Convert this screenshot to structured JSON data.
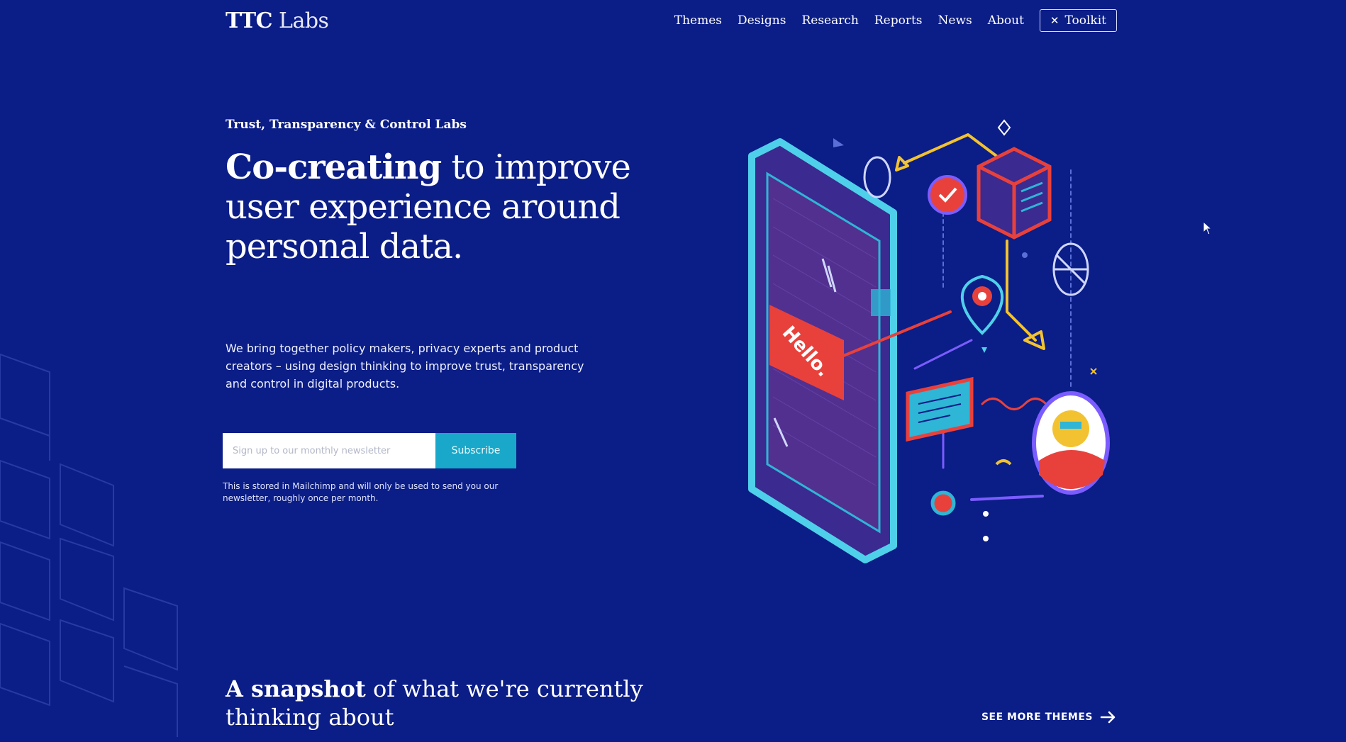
{
  "header": {
    "logo_bold": "TTC",
    "logo_light": "Labs",
    "nav": [
      "Themes",
      "Designs",
      "Research",
      "Reports",
      "News",
      "About"
    ],
    "toolkit_label": "Toolkit",
    "toolkit_icon": "tools-icon"
  },
  "hero": {
    "eyebrow": "Trust, Transparency & Control Labs",
    "headline_strong": "Co-creating",
    "headline_rest": "to improve user experience around personal data.",
    "intro": "We bring together policy makers, privacy experts and product creators – using design thinking to improve trust, transparency and control in digital products.",
    "newsletter": {
      "placeholder": "Sign up to our monthly newsletter",
      "button": "Subscribe",
      "fineprint": "This is stored in Mailchimp and will only be used to send you our newsletter, roughly once per month."
    },
    "illustration": {
      "phone_text": "Hello."
    }
  },
  "snapshot": {
    "title_strong": "A snapshot",
    "title_rest": "of what we're currently thinking about",
    "see_more": "SEE MORE THEMES"
  },
  "colors": {
    "background": "#0b1d86",
    "accent_teal": "#19a8c9",
    "accent_red": "#e8413c",
    "accent_yellow": "#f2c230"
  }
}
